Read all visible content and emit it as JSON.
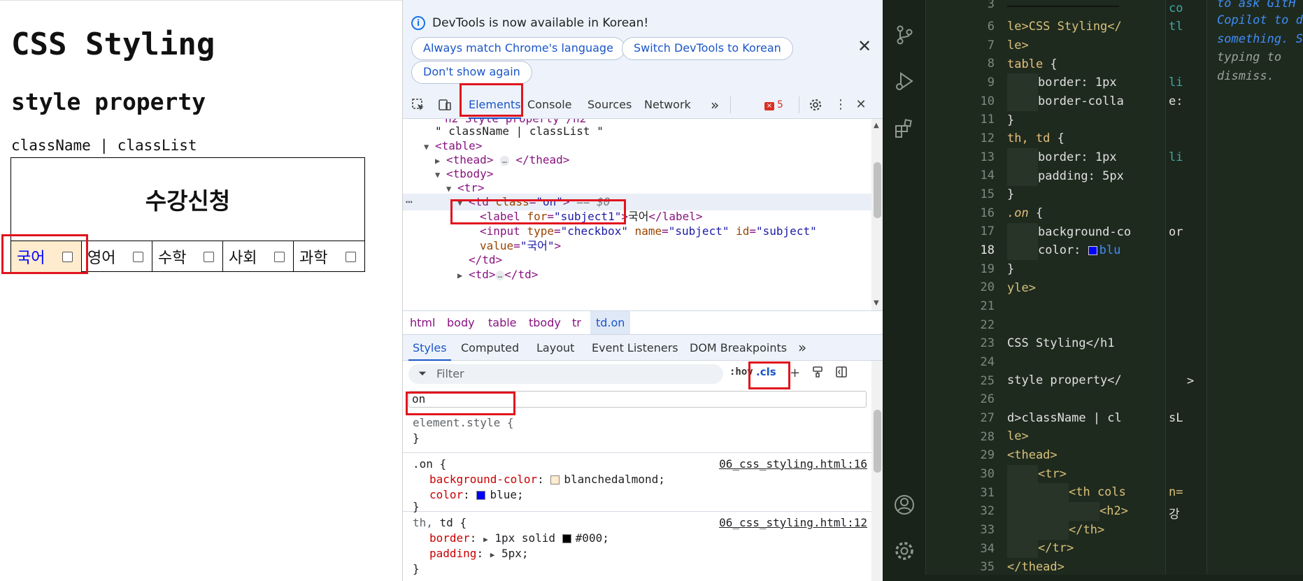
{
  "page": {
    "h1": "CSS Styling",
    "h2": "style property",
    "paragraph": "className | classList",
    "table_title": "수강신청",
    "subjects": [
      "국어",
      "영어",
      "수학",
      "사회",
      "과학"
    ]
  },
  "devtools": {
    "banner": {
      "message": "DevTools is now available in Korean!",
      "btn_match": "Always match Chrome's language",
      "btn_switch": "Switch DevTools to Korean",
      "btn_dont_show": "Don't show again",
      "close": "✕"
    },
    "toolbar": {
      "tab_elements": "Elements",
      "tab_console": "Console",
      "tab_sources": "Sources",
      "tab_network": "Network",
      "more": "»",
      "error_count": "5"
    },
    "dom": {
      "l_text": "\" className | classList \"",
      "l_table": "table",
      "l_thead": "thead",
      "l_tbody": "tbody",
      "l_tr": "tr",
      "l_td": "td",
      "l_class_attr": "class",
      "l_class_val": "\"on\"",
      "l_dollar": "== $0",
      "l_label": "label",
      "l_for": "for",
      "l_for_val": "\"subject1\"",
      "l_label_text": "국어",
      "l_input": "input",
      "l_type": "type",
      "l_type_val": "\"checkbox\"",
      "l_name": "name",
      "l_name_val": "\"subject\"",
      "l_id": "id",
      "l_id_val": "\"subject\"",
      "l_value": "value",
      "l_value_val": "\"국어\"",
      "ellipsis": "…"
    },
    "breadcrumbs": [
      "html",
      "body",
      "table",
      "tbody",
      "tr",
      "td.on"
    ],
    "sub_tabs": [
      "Styles",
      "Computed",
      "Layout",
      "Event Listeners",
      "DOM Breakpoints"
    ],
    "filter": {
      "placeholder": "Filter",
      "hov": ":hov",
      "cls": ".cls"
    },
    "class_input_value": "on",
    "styles": {
      "element_style": "element.style {",
      "close_brace": "}",
      "on_selector": ".on {",
      "on_source": "06_css_styling.html:16",
      "on_bg_prop": "background-color",
      "on_bg_val": "blanchedalmond;",
      "on_color_prop": "color",
      "on_color_val": "blue;",
      "thtd_selector_1": "th,",
      "thtd_selector_2": "td {",
      "thtd_source": "06_css_styling.html:12",
      "thtd_border_prop": "border",
      "thtd_border_val": "1px solid",
      "thtd_border_color": "#000;",
      "thtd_padding_prop": "padding",
      "thtd_padding_val": "5px;"
    },
    "colors": {
      "blanchedalmond": "#ffebcd",
      "blue": "#0000ff",
      "black": "#000000"
    }
  },
  "vscode": {
    "line_numbers": [
      "3",
      "6",
      "7",
      "8",
      "9",
      "10",
      "11",
      "12",
      "13",
      "14",
      "15",
      "16",
      "17",
      "18",
      "19",
      "20",
      "21",
      "22",
      "23",
      "24",
      "25",
      "26",
      "27",
      "28",
      "29",
      "30",
      "31",
      "32",
      "33",
      "34",
      "35"
    ],
    "code": {
      "c6": "le>CSS Styling</",
      "c7": "le>",
      "c8a": "table",
      "c8b": " {",
      "c9": "border: 1px  ",
      "c10": "border-colla",
      "c11": "}",
      "c12a": "th, td",
      "c12b": " {",
      "c13": "border: 1px  ",
      "c14": "padding: 5px",
      "c15": "}",
      "c16a": ".on",
      "c16b": " {",
      "c17": "background-co",
      "c18a": "color: ",
      "c18b": "blu",
      "c19": "}",
      "c20": "yle>",
      "c23": "CSS Styling</h1",
      "c25": "style property</",
      "c27": "d>className | cl",
      "c28": "le>",
      "c29": "<thead>",
      "c30": "<tr>",
      "c31": "<th cols",
      "c32": "<h2>",
      "c33": "</th>",
      "c34": "</tr>",
      "c35": "</thead>"
    },
    "peek": {
      "p_co": "co",
      "p_tl": "tl",
      "p_li1": "li",
      "p_e": "e:",
      "p_li2": "li",
      "p_or": "or",
      "p_gt": ">",
      "p_sL": "sL",
      "p_n": "n=",
      "p_gang": "강"
    },
    "hint": {
      "h1": "to ask GitH",
      "h2": "Copilot to d",
      "h3": "something. S",
      "h4": "typing to",
      "h5": "dismiss."
    }
  }
}
